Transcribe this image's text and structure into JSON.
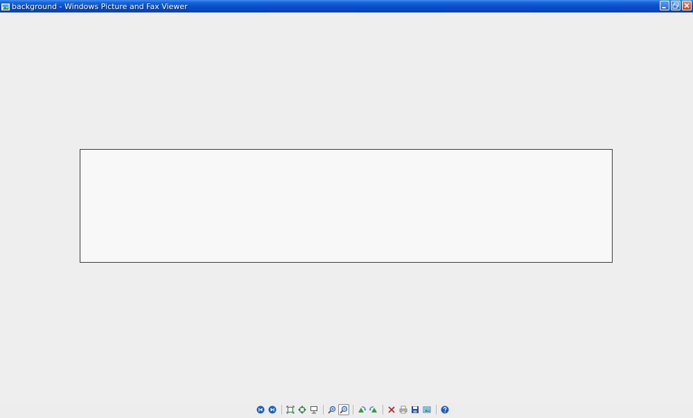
{
  "window": {
    "title": "background - Windows Picture and Fax Viewer"
  },
  "title_controls": [
    {
      "name": "minimize-button",
      "icon": "minimize-icon"
    },
    {
      "name": "restore-button",
      "icon": "restore-icon"
    },
    {
      "name": "close-button",
      "icon": "close-icon"
    }
  ],
  "toolbar": {
    "buttons": [
      {
        "name": "previous-image-button",
        "icon": "previous-icon",
        "color": "#1a5fc8"
      },
      {
        "name": "next-image-button",
        "icon": "next-icon",
        "color": "#1a5fc8"
      },
      {
        "name": "best-fit-button",
        "icon": "best-fit-icon",
        "color": "#2a7a3a"
      },
      {
        "name": "actual-size-button",
        "icon": "actual-size-icon",
        "color": "#2a7a3a"
      },
      {
        "name": "slide-show-button",
        "icon": "slide-show-icon",
        "color": "#555555"
      },
      {
        "name": "zoom-in-button",
        "icon": "zoom-in-icon",
        "color": "#1a5fc8"
      },
      {
        "name": "zoom-out-button",
        "icon": "zoom-out-icon",
        "color": "#1a5fc8",
        "pressed": true
      },
      {
        "name": "rotate-clockwise-button",
        "icon": "rotate-clockwise-icon",
        "color": "#2e9e3e"
      },
      {
        "name": "rotate-counterclockwise-button",
        "icon": "rotate-counterclockwise-icon",
        "color": "#2e9e3e"
      },
      {
        "name": "delete-button",
        "icon": "delete-icon",
        "color": "#cc2020"
      },
      {
        "name": "print-button",
        "icon": "print-icon",
        "color": "#777777"
      },
      {
        "name": "copy-to-button",
        "icon": "save-icon",
        "color": "#2a4aa8"
      },
      {
        "name": "open-for-editing-button",
        "icon": "edit-icon",
        "color": "#2a7aa8"
      },
      {
        "name": "help-button",
        "icon": "help-icon",
        "color": "#1a5fc8"
      }
    ]
  }
}
